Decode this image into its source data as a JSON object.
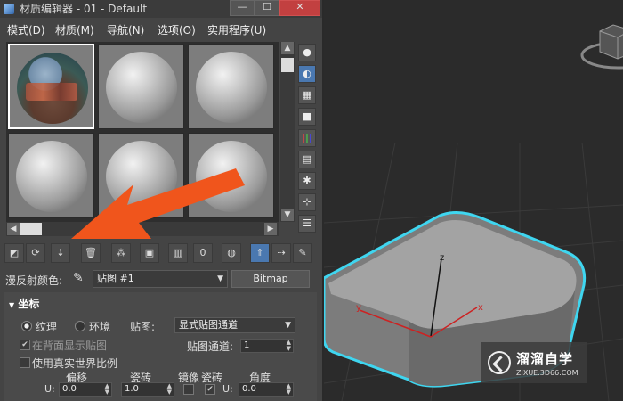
{
  "window": {
    "title": "材质编辑器 - 01 - Default",
    "min_glyph": "—",
    "max_glyph": "☐",
    "close_glyph": "✕"
  },
  "menu": [
    "模式(D)",
    "材质(M)",
    "导航(N)",
    "选项(O)",
    "实用程序(U)"
  ],
  "slots": [
    {
      "type": "photo-map",
      "selected": true
    },
    {
      "type": "default-gray",
      "selected": false
    },
    {
      "type": "default-gray",
      "selected": false
    },
    {
      "type": "default-gray",
      "selected": false
    },
    {
      "type": "default-gray",
      "selected": false
    },
    {
      "type": "default-gray",
      "selected": false
    }
  ],
  "side_buttons": [
    "sphere-type-icon",
    "backlight-icon",
    "checker-background-icon",
    "uv-tiling-icon",
    "video-color-check-icon",
    "make-preview-icon",
    "options-icon",
    "select-by-material-icon",
    "material-map-navigator-icon"
  ],
  "toolbar_buttons": [
    "get-material-icon",
    "put-to-scene-icon",
    "assign-to-selection-icon",
    "reset-map-icon",
    "make-unique-icon",
    "put-to-library-icon",
    "material-id-icon",
    "show-shaded-map-icon",
    "show-end-result-icon",
    "go-to-parent-icon",
    "go-forward-sibling-icon",
    "pick-material-icon"
  ],
  "map_row": {
    "label": "漫反射颜色:",
    "map_name": "贴图 #1",
    "type_button": "Bitmap"
  },
  "coordinates": {
    "header": "坐标",
    "radio_texture": "纹理",
    "radio_environment": "环境",
    "mapping_label": "贴图:",
    "mapping_value": "显式贴图通道",
    "show_map_on_back": "在背面显示贴图",
    "map_channel_label": "贴图通道:",
    "map_channel_value": "1",
    "real_world_scale": "使用真实世界比例",
    "col_offset": "偏移",
    "col_tiling": "瓷砖",
    "col_mirror": "镜像",
    "col_tile": "瓷砖",
    "col_angle": "角度",
    "u_label": "U:",
    "u_offset": "0.0",
    "u_tiling": "1.0",
    "u_angle_label": "U:",
    "u_angle": "0.0"
  },
  "viewport": {
    "axis_x": "x",
    "axis_y": "y",
    "axis_z": "z"
  },
  "watermark": {
    "brand": "溜溜自学",
    "site": "ZIXUE.3D66.COM"
  },
  "colors": {
    "arrow": "#f0551c",
    "selection_outline": "#3fd6f0",
    "accent": "#4a78b0"
  }
}
